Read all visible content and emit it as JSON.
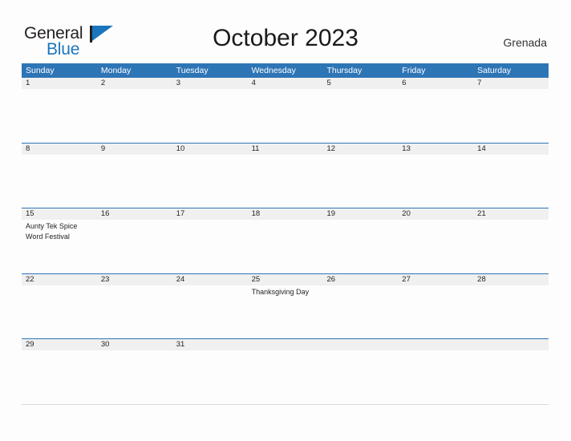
{
  "brand": {
    "name_part1": "General",
    "name_part2": "Blue",
    "flag_icon": "blue-flag-icon",
    "color_dark": "#231f20",
    "color_blue": "#1b75bc"
  },
  "header": {
    "title": "October 2023",
    "location": "Grenada"
  },
  "theme": {
    "header_blue": "#2e75b6",
    "date_band_gray": "#f0f0f0",
    "page_background": "#fdfdfd",
    "text_color": "#231f20"
  },
  "calendar": {
    "month": "October",
    "year": "2023",
    "weekday_headers": [
      "Sunday",
      "Monday",
      "Tuesday",
      "Wednesday",
      "Thursday",
      "Friday",
      "Saturday"
    ],
    "weeks": [
      {
        "days": [
          {
            "number": "1",
            "events": []
          },
          {
            "number": "2",
            "events": []
          },
          {
            "number": "3",
            "events": []
          },
          {
            "number": "4",
            "events": []
          },
          {
            "number": "5",
            "events": []
          },
          {
            "number": "6",
            "events": []
          },
          {
            "number": "7",
            "events": []
          }
        ]
      },
      {
        "days": [
          {
            "number": "8",
            "events": []
          },
          {
            "number": "9",
            "events": []
          },
          {
            "number": "10",
            "events": []
          },
          {
            "number": "11",
            "events": []
          },
          {
            "number": "12",
            "events": []
          },
          {
            "number": "13",
            "events": []
          },
          {
            "number": "14",
            "events": []
          }
        ]
      },
      {
        "days": [
          {
            "number": "15",
            "events": [
              "Aunty Tek Spice Word Festival"
            ]
          },
          {
            "number": "16",
            "events": []
          },
          {
            "number": "17",
            "events": []
          },
          {
            "number": "18",
            "events": []
          },
          {
            "number": "19",
            "events": []
          },
          {
            "number": "20",
            "events": []
          },
          {
            "number": "21",
            "events": []
          }
        ]
      },
      {
        "days": [
          {
            "number": "22",
            "events": []
          },
          {
            "number": "23",
            "events": []
          },
          {
            "number": "24",
            "events": []
          },
          {
            "number": "25",
            "events": [
              "Thanksgiving Day"
            ]
          },
          {
            "number": "26",
            "events": []
          },
          {
            "number": "27",
            "events": []
          },
          {
            "number": "28",
            "events": []
          }
        ]
      },
      {
        "days": [
          {
            "number": "29",
            "events": []
          },
          {
            "number": "30",
            "events": []
          },
          {
            "number": "31",
            "events": []
          },
          {
            "number": "",
            "events": []
          },
          {
            "number": "",
            "events": []
          },
          {
            "number": "",
            "events": []
          },
          {
            "number": "",
            "events": []
          }
        ]
      }
    ]
  }
}
